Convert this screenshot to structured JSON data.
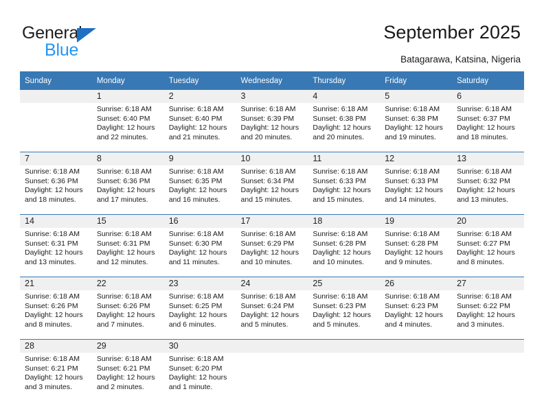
{
  "brand": {
    "name_top": "General",
    "name_bottom": "Blue",
    "triangle_color": "#1f6fc4",
    "blue_text_color": "#2196f3"
  },
  "header": {
    "title": "September 2025",
    "subtitle": "Batagarawa, Katsina, Nigeria"
  },
  "theme": {
    "header_blue": "#3878b4",
    "daynum_band": "#f0f0f0",
    "text": "#1a1a1a"
  },
  "calendar": {
    "weekday_headers": [
      "Sunday",
      "Monday",
      "Tuesday",
      "Wednesday",
      "Thursday",
      "Friday",
      "Saturday"
    ],
    "weeks": [
      [
        {
          "day": "",
          "lines": []
        },
        {
          "day": "1",
          "lines": [
            "Sunrise: 6:18 AM",
            "Sunset: 6:40 PM",
            "Daylight: 12 hours",
            "and 22 minutes."
          ]
        },
        {
          "day": "2",
          "lines": [
            "Sunrise: 6:18 AM",
            "Sunset: 6:40 PM",
            "Daylight: 12 hours",
            "and 21 minutes."
          ]
        },
        {
          "day": "3",
          "lines": [
            "Sunrise: 6:18 AM",
            "Sunset: 6:39 PM",
            "Daylight: 12 hours",
            "and 20 minutes."
          ]
        },
        {
          "day": "4",
          "lines": [
            "Sunrise: 6:18 AM",
            "Sunset: 6:38 PM",
            "Daylight: 12 hours",
            "and 20 minutes."
          ]
        },
        {
          "day": "5",
          "lines": [
            "Sunrise: 6:18 AM",
            "Sunset: 6:38 PM",
            "Daylight: 12 hours",
            "and 19 minutes."
          ]
        },
        {
          "day": "6",
          "lines": [
            "Sunrise: 6:18 AM",
            "Sunset: 6:37 PM",
            "Daylight: 12 hours",
            "and 18 minutes."
          ]
        }
      ],
      [
        {
          "day": "7",
          "lines": [
            "Sunrise: 6:18 AM",
            "Sunset: 6:36 PM",
            "Daylight: 12 hours",
            "and 18 minutes."
          ]
        },
        {
          "day": "8",
          "lines": [
            "Sunrise: 6:18 AM",
            "Sunset: 6:36 PM",
            "Daylight: 12 hours",
            "and 17 minutes."
          ]
        },
        {
          "day": "9",
          "lines": [
            "Sunrise: 6:18 AM",
            "Sunset: 6:35 PM",
            "Daylight: 12 hours",
            "and 16 minutes."
          ]
        },
        {
          "day": "10",
          "lines": [
            "Sunrise: 6:18 AM",
            "Sunset: 6:34 PM",
            "Daylight: 12 hours",
            "and 15 minutes."
          ]
        },
        {
          "day": "11",
          "lines": [
            "Sunrise: 6:18 AM",
            "Sunset: 6:33 PM",
            "Daylight: 12 hours",
            "and 15 minutes."
          ]
        },
        {
          "day": "12",
          "lines": [
            "Sunrise: 6:18 AM",
            "Sunset: 6:33 PM",
            "Daylight: 12 hours",
            "and 14 minutes."
          ]
        },
        {
          "day": "13",
          "lines": [
            "Sunrise: 6:18 AM",
            "Sunset: 6:32 PM",
            "Daylight: 12 hours",
            "and 13 minutes."
          ]
        }
      ],
      [
        {
          "day": "14",
          "lines": [
            "Sunrise: 6:18 AM",
            "Sunset: 6:31 PM",
            "Daylight: 12 hours",
            "and 13 minutes."
          ]
        },
        {
          "day": "15",
          "lines": [
            "Sunrise: 6:18 AM",
            "Sunset: 6:31 PM",
            "Daylight: 12 hours",
            "and 12 minutes."
          ]
        },
        {
          "day": "16",
          "lines": [
            "Sunrise: 6:18 AM",
            "Sunset: 6:30 PM",
            "Daylight: 12 hours",
            "and 11 minutes."
          ]
        },
        {
          "day": "17",
          "lines": [
            "Sunrise: 6:18 AM",
            "Sunset: 6:29 PM",
            "Daylight: 12 hours",
            "and 10 minutes."
          ]
        },
        {
          "day": "18",
          "lines": [
            "Sunrise: 6:18 AM",
            "Sunset: 6:28 PM",
            "Daylight: 12 hours",
            "and 10 minutes."
          ]
        },
        {
          "day": "19",
          "lines": [
            "Sunrise: 6:18 AM",
            "Sunset: 6:28 PM",
            "Daylight: 12 hours",
            "and 9 minutes."
          ]
        },
        {
          "day": "20",
          "lines": [
            "Sunrise: 6:18 AM",
            "Sunset: 6:27 PM",
            "Daylight: 12 hours",
            "and 8 minutes."
          ]
        }
      ],
      [
        {
          "day": "21",
          "lines": [
            "Sunrise: 6:18 AM",
            "Sunset: 6:26 PM",
            "Daylight: 12 hours",
            "and 8 minutes."
          ]
        },
        {
          "day": "22",
          "lines": [
            "Sunrise: 6:18 AM",
            "Sunset: 6:26 PM",
            "Daylight: 12 hours",
            "and 7 minutes."
          ]
        },
        {
          "day": "23",
          "lines": [
            "Sunrise: 6:18 AM",
            "Sunset: 6:25 PM",
            "Daylight: 12 hours",
            "and 6 minutes."
          ]
        },
        {
          "day": "24",
          "lines": [
            "Sunrise: 6:18 AM",
            "Sunset: 6:24 PM",
            "Daylight: 12 hours",
            "and 5 minutes."
          ]
        },
        {
          "day": "25",
          "lines": [
            "Sunrise: 6:18 AM",
            "Sunset: 6:23 PM",
            "Daylight: 12 hours",
            "and 5 minutes."
          ]
        },
        {
          "day": "26",
          "lines": [
            "Sunrise: 6:18 AM",
            "Sunset: 6:23 PM",
            "Daylight: 12 hours",
            "and 4 minutes."
          ]
        },
        {
          "day": "27",
          "lines": [
            "Sunrise: 6:18 AM",
            "Sunset: 6:22 PM",
            "Daylight: 12 hours",
            "and 3 minutes."
          ]
        }
      ],
      [
        {
          "day": "28",
          "lines": [
            "Sunrise: 6:18 AM",
            "Sunset: 6:21 PM",
            "Daylight: 12 hours",
            "and 3 minutes."
          ]
        },
        {
          "day": "29",
          "lines": [
            "Sunrise: 6:18 AM",
            "Sunset: 6:21 PM",
            "Daylight: 12 hours",
            "and 2 minutes."
          ]
        },
        {
          "day": "30",
          "lines": [
            "Sunrise: 6:18 AM",
            "Sunset: 6:20 PM",
            "Daylight: 12 hours",
            "and 1 minute."
          ]
        },
        {
          "day": "",
          "lines": []
        },
        {
          "day": "",
          "lines": []
        },
        {
          "day": "",
          "lines": []
        },
        {
          "day": "",
          "lines": []
        }
      ]
    ]
  }
}
